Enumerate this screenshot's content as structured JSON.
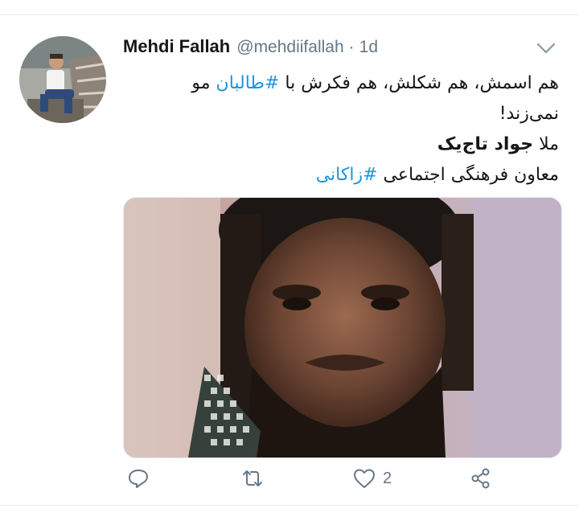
{
  "tweet": {
    "author_name": "Mehdi Fallah",
    "handle": "@mehdiifallah",
    "separator": "·",
    "time": "1d",
    "line1_text": "هم اسمش، هم شکلش، هم فکرش با ",
    "line1_hashtag": "#طالبان",
    "line1_suffix": " مو",
    "line2": "نمی‌زند!",
    "line3_prefix": "ملا ",
    "line3_bold": "جواد تاج‌یک",
    "line4_text": "معاون فرهنگی اجتماعی ",
    "line4_hashtag": "#زاکانی",
    "like_count": "2"
  },
  "colors": {
    "hashtag": "#1b95e0",
    "secondary_text": "#657786",
    "primary_text": "#14171a"
  },
  "icons": {
    "reply": "reply-icon",
    "retweet": "retweet-icon",
    "like": "heart-icon",
    "share": "share-icon",
    "menu": "chevron-down-icon"
  }
}
